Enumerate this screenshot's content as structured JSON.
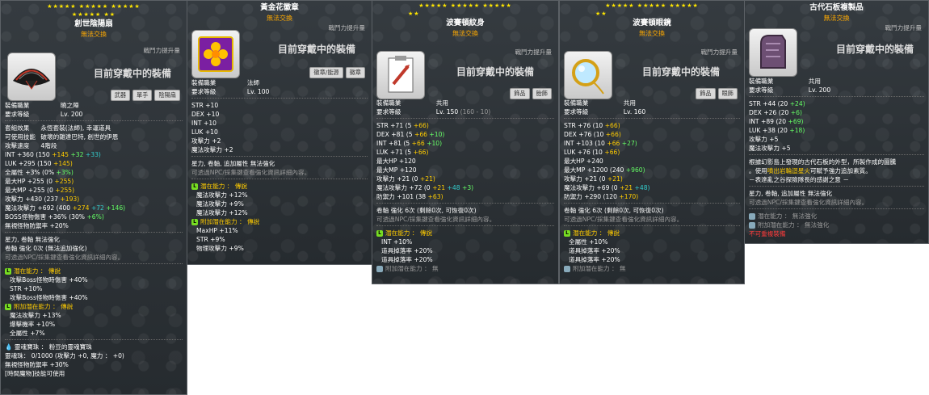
{
  "colors": {
    "panel_bg": "#2e3438",
    "gold": "#ffcc00",
    "green": "#66ff66",
    "aqua": "#33cccc",
    "orange": "#ffaa00",
    "legendary": "#77dd22",
    "red": "#ff3b3b"
  },
  "common": {
    "power_label": "戰鬥力提升量",
    "equipped_label": "目前穿戴中的裝備",
    "no_trade": "無法交換",
    "job_label": "裝備職業",
    "level_label": "要求等級",
    "star_tip": "星力, 卷軸 無法強化",
    "npc_tip": "可透過NPC/採集鍵查看強化資訊詳細內容。",
    "potential_title": "潛在能力 ： 傳說",
    "add_potential_title": "附加潛在能力 ： 傳說"
  },
  "panel1": {
    "stars_row1": "★★★★★ ★★★★★ ★★★★★",
    "stars_row2": "★★★★★ ★★",
    "title": "創世陰陽扇",
    "subtitle": "無法交換",
    "icon": "fan-icon",
    "tags": [
      "武器",
      "單手",
      "陰陽扇"
    ],
    "job": "曉之陣",
    "level": "Lv. 200",
    "set_effect_label": "套組效果",
    "set_effect_text": "永恆套裝(法師), 幸運道具",
    "usable_skill_label": "可使用技能",
    "usable_skill_text": "破壞的雜達巴特, 創世的伊恩",
    "atk_speed_label": "攻擊速度",
    "atk_speed_text": "4階段",
    "int_line": {
      "label": "INT",
      "total": "+360",
      "base": "(150",
      "a": "+145",
      "b": "+32",
      "c": "+33)"
    },
    "luk_line": {
      "label": "LUK",
      "total": "+295",
      "base": "(150",
      "a": "+145)"
    },
    "allstat_line": {
      "label": "全屬性",
      "total": "+3%",
      "base": "(0%",
      "a": "+3%)"
    },
    "maxhp_line": {
      "label": "最大HP",
      "total": "+255",
      "base": "(0",
      "a": "+255)"
    },
    "maxmp_line": {
      "label": "最大MP",
      "total": "+255",
      "base": "(0",
      "a": "+255)"
    },
    "atk_line": {
      "label": "攻擊力",
      "total": "+430",
      "base": "(237",
      "a": "+193)"
    },
    "matk_line": {
      "label": "魔法攻擊力",
      "total": "+692",
      "base": "(400",
      "a": "+274",
      "b": "+72",
      "c": "+146)"
    },
    "boss_line": {
      "label": "BOSS怪物傷害",
      "total": "+36%",
      "base": "(30%",
      "a": "+6%)"
    },
    "ignore_line": "無視怪物防禦率 +20%",
    "star_tip": "星力, 卷軸 無法強化",
    "scroll_line": "卷軸 強化 0次 (無法追加強化)",
    "npc_tip": "可透過NPC/採集鍵查看強化資訊詳細內容。",
    "potential_title": "潛在能力 ： 傳說",
    "potentials": [
      "攻擊Boss怪物時傷害 +40%",
      "STR +10%",
      "攻擊Boss怪物時傷害 +40%"
    ],
    "add_potential_title": "附加潛在能力 ： 傳說",
    "add_potentials": [
      "魔法攻擊力 +13%",
      "爆擊機率 +10%",
      "全屬性 +7%"
    ],
    "soul_line": "靈魂寶珠 ： 粉豆的靈魂寶珠",
    "soul_charge": "靈魂珠： 0/1000 (攻擊力 +0, 魔力 ： +0)",
    "soul_ignore": "無視怪物防禦率 +30%",
    "soul_skill": "[時間魔物]技能可使用"
  },
  "panel2": {
    "title": "黃金花徽章",
    "subtitle": "無法交換",
    "icon": "gold-flower-badge-icon",
    "tags": [
      "徽章/能源",
      "徽章"
    ],
    "job": "法師",
    "level": "Lv. 100",
    "stats": [
      [
        "STR",
        "+10"
      ],
      [
        "DEX",
        "+10"
      ],
      [
        "INT",
        "+10"
      ],
      [
        "LUK",
        "+10"
      ],
      [
        "攻擊力",
        "+2"
      ],
      [
        "魔法攻擊力",
        "+2"
      ]
    ],
    "star_tip": "星力, 卷軸, 追加屬性 無法強化",
    "npc_tip": "可透過NPC/採集鍵查看強化資訊詳細內容。",
    "potential_title": "潛在能力 ： 傳說",
    "potentials": [
      "魔法攻擊力 +12%",
      "魔法攻擊力 +9%",
      "魔法攻擊力 +12%"
    ],
    "add_potential_title": "附加潛在能力 ： 傳說",
    "add_potentials": [
      "MaxHP +11%",
      "STR +9%",
      "物理攻擊力 +9%"
    ]
  },
  "panel3": {
    "stars_row1": "★★★★★ ★★★★★ ★★★★★",
    "stars_row2": "★★",
    "title": "波賽頓紋身",
    "subtitle": "無法交換",
    "icon": "poseidon-tattoo-icon",
    "tags": [
      "飾品",
      "胎飾"
    ],
    "job": "共用",
    "level": "Lv. 150",
    "level_extra": "(160 - 10)",
    "stats": [
      {
        "label": "STR",
        "total": "+71",
        "base": "(5",
        "a": "+66)"
      },
      {
        "label": "DEX",
        "total": "+81",
        "base": "(5",
        "a": "+66",
        "b": "+10)"
      },
      {
        "label": "INT",
        "total": "+81",
        "base": "(5",
        "a": "+66",
        "b": "+10)"
      },
      {
        "label": "LUK",
        "total": "+71",
        "base": "(5",
        "a": "+66)"
      },
      {
        "label": "最大HP",
        "total": "+120"
      },
      {
        "label": "最大MP",
        "total": "+120"
      },
      {
        "label": "攻擊力",
        "total": "+21",
        "base": "(0",
        "a": "+21)"
      },
      {
        "label": "魔法攻擊力",
        "total": "+72",
        "base": "(0",
        "a": "+21",
        "b": "+48",
        "c": "+3)"
      },
      {
        "label": "防禦力",
        "total": "+101",
        "base": "(38",
        "a": "+63)"
      }
    ],
    "scroll_line": "卷軸 強化 6次 (剩餘0次, 可恢復0次)",
    "npc_tip": "可透過NPC/採集鍵查看強化資訊詳細內容。",
    "potential_title": "潛在能力 ： 傳說",
    "potentials": [
      "INT +10%",
      "道具掉落率 +20%",
      "道具掉落率 +20%"
    ],
    "add_potential_title": "附加潛在能力 ： 無"
  },
  "panel4": {
    "stars_row1": "★★★★★ ★★★★★ ★★★★★",
    "stars_row2": "★★",
    "title": "波賽頓眼鏡",
    "subtitle": "無法交換",
    "icon": "poseidon-glasses-icon",
    "tags": [
      "飾品",
      "眼飾"
    ],
    "job": "共用",
    "level": "Lv. 160",
    "stats": [
      {
        "label": "STR",
        "total": "+76",
        "base": "(10",
        "a": "+66)"
      },
      {
        "label": "DEX",
        "total": "+76",
        "base": "(10",
        "a": "+66)"
      },
      {
        "label": "INT",
        "total": "+103",
        "base": "(10",
        "a": "+66",
        "b": "+27)"
      },
      {
        "label": "LUK",
        "total": "+76",
        "base": "(10",
        "a": "+66)"
      },
      {
        "label": "最大HP",
        "total": "+240"
      },
      {
        "label": "最大MP",
        "total": "+1200",
        "base": "(240",
        "a": "+960)"
      },
      {
        "label": "攻擊力",
        "total": "+21",
        "base": "(0",
        "a": "+21)"
      },
      {
        "label": "魔法攻擊力",
        "total": "+69",
        "base": "(0",
        "a": "+21",
        "b": "+48)"
      },
      {
        "label": "防禦力",
        "total": "+290",
        "base": "(120",
        "a": "+170)"
      }
    ],
    "scroll_line": "卷軸 強化 6次 (剩餘0次, 可恢復0次)",
    "npc_tip": "可透過NPC/採集鍵查看強化資訊詳細內容。",
    "potential_title": "潛在能力 ： 傳說",
    "potentials": [
      "全屬性 +10%",
      "道具掉落率 +20%",
      "道具掉落率 +20%"
    ],
    "add_potential_title": "附加潛在能力 ： 無"
  },
  "panel5": {
    "title": "古代石板複製品",
    "subtitle": "無法交換",
    "icon": "ancient-stone-tablet-icon",
    "job": "共用",
    "level": "Lv. 200",
    "stats": [
      {
        "label": "STR",
        "total": "+44",
        "base": "(20",
        "a": "+24)"
      },
      {
        "label": "DEX",
        "total": "+26",
        "base": "(20",
        "a": "+6)"
      },
      {
        "label": "INT",
        "total": "+89",
        "base": "(20",
        "a": "+69)"
      },
      {
        "label": "LUK",
        "total": "+38",
        "base": "(20",
        "a": "+18)"
      },
      {
        "label": "攻擊力",
        "total": "+5"
      },
      {
        "label": "魔法攻擊力",
        "total": "+5"
      }
    ],
    "desc1": "根據幻影島上發現的古代石板的外型，所製作成的圖騰",
    "desc2_pre": "。使用",
    "desc2_hl": "噴出岩輪迴星火",
    "desc2_post": "可賦予強力追加素質。",
    "desc3": "－表達亂之谷探險隊長的感謝之意 －",
    "star_tip": "星力, 卷軸, 追加屬性 無法強化",
    "npc_tip": "可透過NPC/採集鍵查看強化資訊詳細內容。",
    "potential_line": "潛在能力 ： 無法強化",
    "add_potential_line": "附加潛在能力 ： 無法強化",
    "no_repeat": "不可重複裝備"
  }
}
